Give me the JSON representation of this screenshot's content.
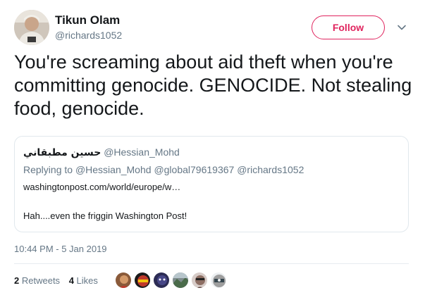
{
  "author": {
    "name": "Tikun Olam",
    "handle": "@richards1052",
    "avatar_icon": "user-avatar"
  },
  "follow_label": "Follow",
  "accent_color": "#e0245e",
  "tweet_text": "You're screaming about aid theft when you're committing genocide. GENOCIDE. Not stealing food, genocide.",
  "quoted": {
    "name": "حسين مطبقاني",
    "handle": "@Hessian_Mohd",
    "replying_prefix": "Replying to",
    "replying_to": [
      "@Hessian_Mohd",
      "@global79619367",
      "@richards1052"
    ],
    "link": "washingtonpost.com/world/europe/w…",
    "body": "Hah....even the friggin Washington Post!"
  },
  "timestamp": "10:44 PM - 5 Jan 2019",
  "stats": {
    "retweets_count": "2",
    "retweets_label": "Retweets",
    "likes_count": "4",
    "likes_label": "Likes"
  },
  "likers_icons": [
    "liker-avatar-1",
    "liker-avatar-2",
    "liker-avatar-3",
    "liker-avatar-4",
    "liker-avatar-5",
    "liker-avatar-6"
  ]
}
